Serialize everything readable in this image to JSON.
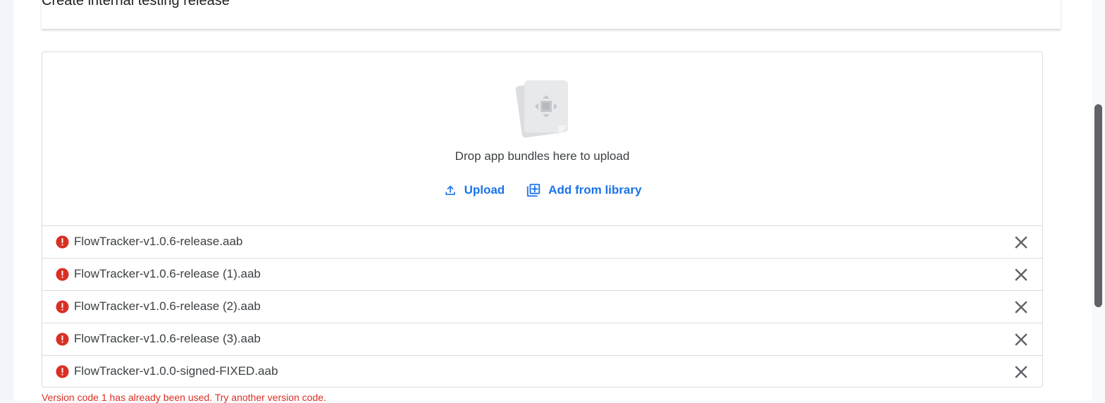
{
  "page": {
    "title": "Create internal testing release"
  },
  "dropzone": {
    "illustration_icon": "app-bundle-icon",
    "drop_text": "Drop app bundles here to upload",
    "upload_label": "Upload",
    "upload_icon": "upload-icon",
    "library_label": "Add from library",
    "library_icon": "library-add-icon"
  },
  "files": [
    {
      "name": "FlowTracker-v1.0.6-release.aab",
      "status": "error"
    },
    {
      "name": "FlowTracker-v1.0.6-release (1).aab",
      "status": "error"
    },
    {
      "name": "FlowTracker-v1.0.6-release (2).aab",
      "status": "error"
    },
    {
      "name": "FlowTracker-v1.0.6-release (3).aab",
      "status": "error"
    },
    {
      "name": "FlowTracker-v1.0.0-signed-FIXED.aab",
      "status": "error"
    }
  ],
  "error_message": "Version code 1 has already been used. Try another version code.",
  "colors": {
    "accent": "#1a73e8",
    "error": "#d93025",
    "border": "#dadce0",
    "text": "#3c4043"
  }
}
